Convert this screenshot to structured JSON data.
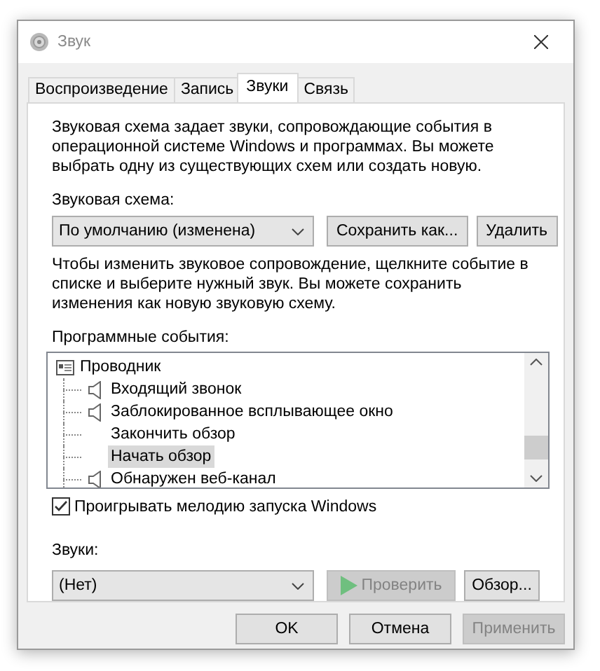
{
  "window": {
    "title": "Звук"
  },
  "tabs": [
    {
      "label": "Воспроизведение",
      "selected": false
    },
    {
      "label": "Запись",
      "selected": false
    },
    {
      "label": "Звуки",
      "selected": true
    },
    {
      "label": "Связь",
      "selected": false
    }
  ],
  "description": "Звуковая схема задает звуки, сопровождающие события в операционной системе Windows и программах. Вы можете выбрать одну из существующих схем или создать новую.",
  "scheme": {
    "label": "Звуковая схема:",
    "value": "По умолчанию (изменена)"
  },
  "scheme_buttons": [
    {
      "label": "Сохранить как...",
      "disabled": false
    },
    {
      "label": "Удалить",
      "disabled": false
    }
  ],
  "instructions": "Чтобы изменить звуковое сопровождение, щелкните событие в списке и выберите нужный звук. Вы можете сохранить изменения как новую звуковую схему.",
  "events": {
    "label": "Программные события:",
    "items": [
      {
        "label": "Проводник",
        "selected": false,
        "children": [
          {
            "label": "Входящий звонок",
            "sound": true,
            "selected": false
          },
          {
            "label": "Заблокированное всплывающее окно",
            "sound": true,
            "selected": false
          },
          {
            "label": "Закончить обзор",
            "sound": false,
            "selected": false
          },
          {
            "label": "Начать обзор",
            "sound": false,
            "selected": true
          },
          {
            "label": "Обнаружен веб-канал",
            "sound": true,
            "selected": false
          }
        ]
      }
    ]
  },
  "startup_sound": {
    "label": "Проигрывать мелодию запуска Windows",
    "checked": true
  },
  "sounds": {
    "label": "Звуки:",
    "value": "(Нет)"
  },
  "sound_buttons": [
    {
      "kind": "play",
      "label": "Проверить",
      "disabled": true
    },
    {
      "kind": "plain",
      "label": "Обзор...",
      "disabled": false
    }
  ],
  "dialog_buttons": [
    {
      "label": "OK",
      "disabled": false
    },
    {
      "label": "Отмена",
      "disabled": false
    },
    {
      "label": "Применить",
      "disabled": true
    }
  ]
}
